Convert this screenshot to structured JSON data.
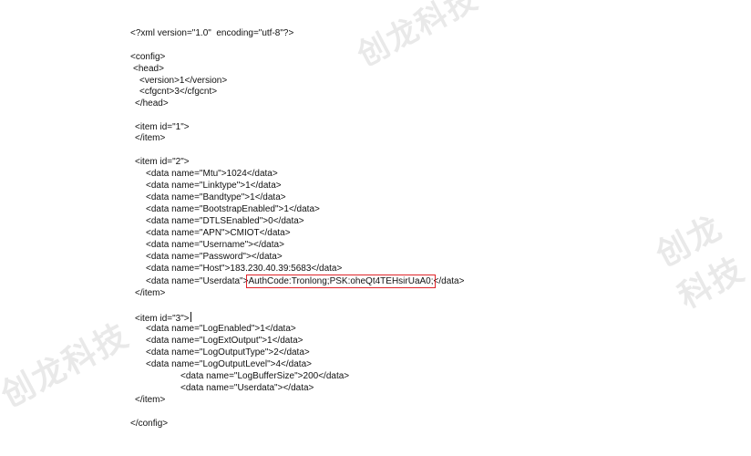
{
  "watermark": "创龙科技",
  "lines": [
    "<?xml version=\"1.0\"  encoding=\"utf-8\"?>",
    "<config>",
    "<head>",
    "<version>1</version>",
    "<cfgcnt>3</cfgcnt>",
    "</head>",
    "<item id=\"1\">",
    "</item>",
    "<item id=\"2\">",
    "<data name=\"Mtu\">1024</data>",
    "<data name=\"Linktype\">1</data>",
    "<data name=\"Bandtype\">1</data>",
    "<data name=\"BootstrapEnabled\">1</data>",
    "<data name=\"DTLSEnabled\">0</data>",
    "<data name=\"APN\">CMIOT</data>",
    "<data name=\"Username\"></data>",
    "<data name=\"Password\"></data>",
    "<data name=\"Host\">183.230.40.39:5683</data>",
    "</item>",
    "<item id=\"3\">",
    "<data name=\"LogEnabled\">1</data>",
    "<data name=\"LogExtOutput\">1</data>",
    "<data name=\"LogOutputType\">2</data>",
    "<data name=\"LogOutputLevel\">4</data>",
    "<data name=\"LogBufferSize\">200</data>",
    "<data name=\"Userdata\"></data>",
    "</item>",
    "</config>"
  ],
  "userdata_line": {
    "prefix": "<data name=\"Userdata\">",
    "highlighted": "AuthCode:Tronlong;PSK:oheQt4TEHsirUaA0;",
    "suffix": "</data>"
  },
  "highlight_color": "#e0242a"
}
